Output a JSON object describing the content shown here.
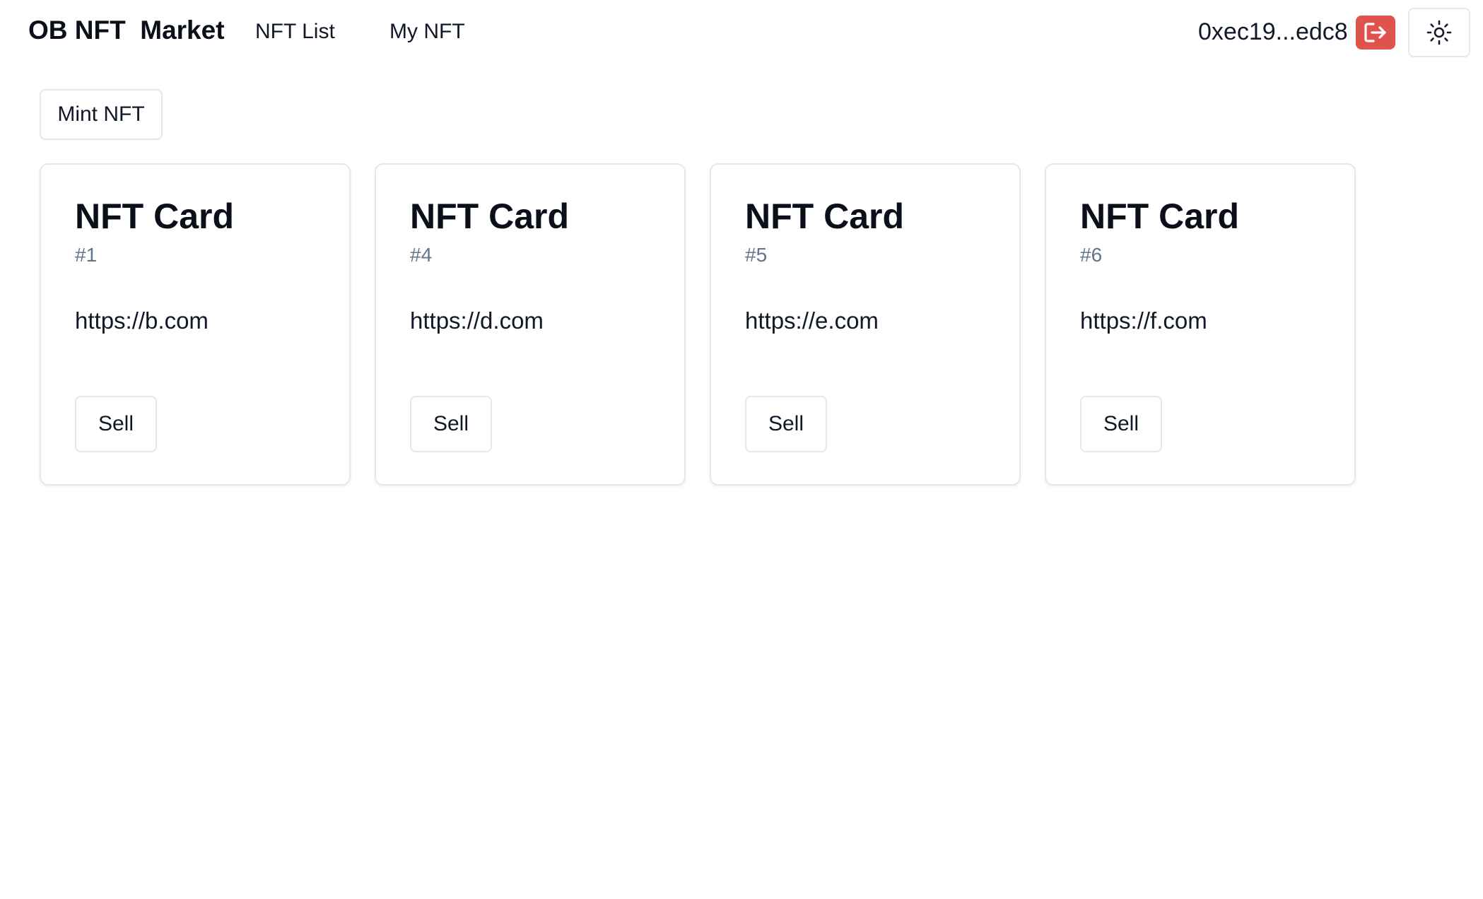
{
  "header": {
    "brand": "OB NFT  Market",
    "nav": [
      {
        "label": "NFT List"
      },
      {
        "label": "My NFT"
      }
    ],
    "wallet_address": "0xec19...edc8",
    "logout_icon": "logout-icon",
    "theme_icon": "sun-icon"
  },
  "main": {
    "mint_label": "Mint NFT",
    "cards": [
      {
        "title": "NFT Card",
        "id": "#1",
        "url": "https://b.com",
        "sell_label": "Sell"
      },
      {
        "title": "NFT Card",
        "id": "#4",
        "url": "https://d.com",
        "sell_label": "Sell"
      },
      {
        "title": "NFT Card",
        "id": "#5",
        "url": "https://e.com",
        "sell_label": "Sell"
      },
      {
        "title": "NFT Card",
        "id": "#6",
        "url": "https://f.com",
        "sell_label": "Sell"
      }
    ]
  },
  "colors": {
    "logout_bg": "#e0524c",
    "muted_text": "#64748b",
    "border": "#e5e7eb"
  }
}
